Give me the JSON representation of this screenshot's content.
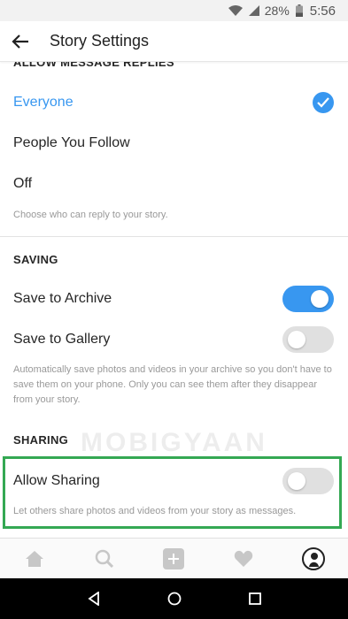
{
  "status_bar": {
    "battery_percent": "28%",
    "time": "5:56",
    "icons": [
      "wifi-icon",
      "signal-icon",
      "battery-icon"
    ]
  },
  "header": {
    "title": "Story Settings",
    "back_icon": "back-arrow-icon"
  },
  "message_replies": {
    "heading": "ALLOW MESSAGE REPLIES",
    "options": [
      {
        "label": "Everyone",
        "selected": true
      },
      {
        "label": "People You Follow",
        "selected": false
      },
      {
        "label": "Off",
        "selected": false
      }
    ],
    "helper": "Choose who can reply to your story."
  },
  "saving": {
    "heading": "SAVING",
    "items": [
      {
        "label": "Save to Archive",
        "enabled": true
      },
      {
        "label": "Save to Gallery",
        "enabled": false
      }
    ],
    "helper": "Automatically save photos and videos in your archive so you don't have to save them on your phone. Only you can see them after they disappear from your story."
  },
  "sharing": {
    "heading": "SHARING",
    "items": [
      {
        "label": "Allow Sharing",
        "enabled": false
      }
    ],
    "helper": "Let others share photos and videos from your story as messages."
  },
  "watermark": "MOBIGYAAN",
  "tab_bar": {
    "tabs": [
      "home-icon",
      "search-icon",
      "add-icon",
      "heart-icon",
      "profile-avatar"
    ]
  },
  "colors": {
    "accent": "#3897f0",
    "highlight": "#34a853",
    "toggle_off": "#e0e0e0"
  }
}
